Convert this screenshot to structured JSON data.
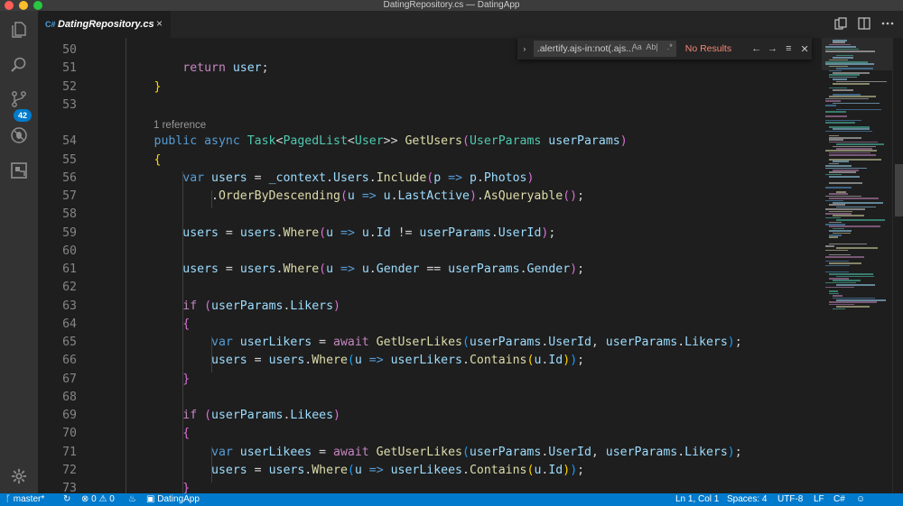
{
  "window": {
    "title": "DatingRepository.cs — DatingApp"
  },
  "activity_bar": {
    "scm_badge": "42"
  },
  "tab": {
    "icon_label": "C#",
    "name": "DatingRepository.cs",
    "close": "×"
  },
  "find_widget": {
    "toggle": "›",
    "query": ".alertify.ajs-in:not(.ajs...",
    "opt_case": "Aa",
    "opt_word": "Ab|",
    "opt_regex": ".*",
    "result": "No Results",
    "prev": "←",
    "next": "→",
    "selection": "≡",
    "close": "✕"
  },
  "editor": {
    "codelens": "1 reference",
    "lines": [
      {
        "n": "50",
        "tokens": []
      },
      {
        "n": "51",
        "tokens": [
          [
            "ctl",
            "            return"
          ],
          [
            "var",
            " user"
          ],
          [
            "pn",
            ";"
          ]
        ]
      },
      {
        "n": "52",
        "tokens": [
          [
            "br",
            "        }"
          ]
        ]
      },
      {
        "n": "53",
        "tokens": []
      },
      {
        "n": "54",
        "tokens": [
          [
            "kw",
            "        public async "
          ],
          [
            "ty",
            "Task"
          ],
          [
            "pn",
            "<"
          ],
          [
            "ty",
            "PagedList"
          ],
          [
            "pn",
            "<"
          ],
          [
            "ty",
            "User"
          ],
          [
            "pn",
            ">> "
          ],
          [
            "fn",
            "GetUsers"
          ],
          [
            "br2",
            "("
          ],
          [
            "ty",
            "UserParams"
          ],
          [
            "var",
            " userParams"
          ],
          [
            "br2",
            ")"
          ]
        ]
      },
      {
        "n": "55",
        "tokens": [
          [
            "br",
            "        {"
          ]
        ]
      },
      {
        "n": "56",
        "tokens": [
          [
            "kw",
            "            var"
          ],
          [
            "var",
            " users"
          ],
          [
            "pn",
            " = "
          ],
          [
            "var",
            "_context"
          ],
          [
            "pn",
            "."
          ],
          [
            "var",
            "Users"
          ],
          [
            "pn",
            "."
          ],
          [
            "fn",
            "Include"
          ],
          [
            "br2",
            "("
          ],
          [
            "var",
            "p"
          ],
          [
            "kw",
            " =>"
          ],
          [
            "var",
            " p"
          ],
          [
            "pn",
            "."
          ],
          [
            "var",
            "Photos"
          ],
          [
            "br2",
            ")"
          ]
        ]
      },
      {
        "n": "57",
        "tokens": [
          [
            "pn",
            "                ."
          ],
          [
            "fn",
            "OrderByDescending"
          ],
          [
            "br2",
            "("
          ],
          [
            "var",
            "u"
          ],
          [
            "kw",
            " =>"
          ],
          [
            "var",
            " u"
          ],
          [
            "pn",
            "."
          ],
          [
            "var",
            "LastActive"
          ],
          [
            "br2",
            ")"
          ],
          [
            "pn",
            "."
          ],
          [
            "fn",
            "AsQueryable"
          ],
          [
            "br2",
            "()"
          ],
          [
            "pn",
            ";"
          ]
        ]
      },
      {
        "n": "58",
        "tokens": []
      },
      {
        "n": "59",
        "tokens": [
          [
            "var",
            "            users"
          ],
          [
            "pn",
            " = "
          ],
          [
            "var",
            "users"
          ],
          [
            "pn",
            "."
          ],
          [
            "fn",
            "Where"
          ],
          [
            "br2",
            "("
          ],
          [
            "var",
            "u"
          ],
          [
            "kw",
            " =>"
          ],
          [
            "var",
            " u"
          ],
          [
            "pn",
            "."
          ],
          [
            "var",
            "Id"
          ],
          [
            "pn",
            " != "
          ],
          [
            "var",
            "userParams"
          ],
          [
            "pn",
            "."
          ],
          [
            "var",
            "UserId"
          ],
          [
            "br2",
            ")"
          ],
          [
            "pn",
            ";"
          ]
        ]
      },
      {
        "n": "60",
        "tokens": []
      },
      {
        "n": "61",
        "tokens": [
          [
            "var",
            "            users"
          ],
          [
            "pn",
            " = "
          ],
          [
            "var",
            "users"
          ],
          [
            "pn",
            "."
          ],
          [
            "fn",
            "Where"
          ],
          [
            "br2",
            "("
          ],
          [
            "var",
            "u"
          ],
          [
            "kw",
            " =>"
          ],
          [
            "var",
            " u"
          ],
          [
            "pn",
            "."
          ],
          [
            "var",
            "Gender"
          ],
          [
            "pn",
            " == "
          ],
          [
            "var",
            "userParams"
          ],
          [
            "pn",
            "."
          ],
          [
            "var",
            "Gender"
          ],
          [
            "br2",
            ")"
          ],
          [
            "pn",
            ";"
          ]
        ]
      },
      {
        "n": "62",
        "tokens": []
      },
      {
        "n": "63",
        "tokens": [
          [
            "ctl",
            "            if"
          ],
          [
            "br2",
            " ("
          ],
          [
            "var",
            "userParams"
          ],
          [
            "pn",
            "."
          ],
          [
            "var",
            "Likers"
          ],
          [
            "br2",
            ")"
          ]
        ]
      },
      {
        "n": "64",
        "tokens": [
          [
            "br2",
            "            {"
          ]
        ]
      },
      {
        "n": "65",
        "tokens": [
          [
            "kw",
            "                var"
          ],
          [
            "var",
            " userLikers"
          ],
          [
            "pn",
            " = "
          ],
          [
            "ctl",
            "await "
          ],
          [
            "fn",
            "GetUserLikes"
          ],
          [
            "br3",
            "("
          ],
          [
            "var",
            "userParams"
          ],
          [
            "pn",
            "."
          ],
          [
            "var",
            "UserId"
          ],
          [
            "pn",
            ", "
          ],
          [
            "var",
            "userParams"
          ],
          [
            "pn",
            "."
          ],
          [
            "var",
            "Likers"
          ],
          [
            "br3",
            ")"
          ],
          [
            "pn",
            ";"
          ]
        ]
      },
      {
        "n": "66",
        "tokens": [
          [
            "var",
            "                users"
          ],
          [
            "pn",
            " = "
          ],
          [
            "var",
            "users"
          ],
          [
            "pn",
            "."
          ],
          [
            "fn",
            "Where"
          ],
          [
            "br3",
            "("
          ],
          [
            "var",
            "u"
          ],
          [
            "kw",
            " =>"
          ],
          [
            "var",
            " userLikers"
          ],
          [
            "pn",
            "."
          ],
          [
            "fn",
            "Contains"
          ],
          [
            "br",
            "("
          ],
          [
            "var",
            "u"
          ],
          [
            "pn",
            "."
          ],
          [
            "var",
            "Id"
          ],
          [
            "br",
            ")"
          ],
          [
            "br3",
            ")"
          ],
          [
            "pn",
            ";"
          ]
        ]
      },
      {
        "n": "67",
        "tokens": [
          [
            "br2",
            "            }"
          ]
        ]
      },
      {
        "n": "68",
        "tokens": []
      },
      {
        "n": "69",
        "tokens": [
          [
            "ctl",
            "            if"
          ],
          [
            "br2",
            " ("
          ],
          [
            "var",
            "userParams"
          ],
          [
            "pn",
            "."
          ],
          [
            "var",
            "Likees"
          ],
          [
            "br2",
            ")"
          ]
        ]
      },
      {
        "n": "70",
        "tokens": [
          [
            "br2",
            "            {"
          ]
        ]
      },
      {
        "n": "71",
        "tokens": [
          [
            "kw",
            "                var"
          ],
          [
            "var",
            " userLikees"
          ],
          [
            "pn",
            " = "
          ],
          [
            "ctl",
            "await "
          ],
          [
            "fn",
            "GetUserLikes"
          ],
          [
            "br3",
            "("
          ],
          [
            "var",
            "userParams"
          ],
          [
            "pn",
            "."
          ],
          [
            "var",
            "UserId"
          ],
          [
            "pn",
            ", "
          ],
          [
            "var",
            "userParams"
          ],
          [
            "pn",
            "."
          ],
          [
            "var",
            "Likers"
          ],
          [
            "br3",
            ")"
          ],
          [
            "pn",
            ";"
          ]
        ]
      },
      {
        "n": "72",
        "tokens": [
          [
            "var",
            "                users"
          ],
          [
            "pn",
            " = "
          ],
          [
            "var",
            "users"
          ],
          [
            "pn",
            "."
          ],
          [
            "fn",
            "Where"
          ],
          [
            "br3",
            "("
          ],
          [
            "var",
            "u"
          ],
          [
            "kw",
            " =>"
          ],
          [
            "var",
            " userLikees"
          ],
          [
            "pn",
            "."
          ],
          [
            "fn",
            "Contains"
          ],
          [
            "br",
            "("
          ],
          [
            "var",
            "u"
          ],
          [
            "pn",
            "."
          ],
          [
            "var",
            "Id"
          ],
          [
            "br",
            ")"
          ],
          [
            "br3",
            ")"
          ],
          [
            "pn",
            ";"
          ]
        ]
      },
      {
        "n": "73",
        "tokens": [
          [
            "br2",
            "            }"
          ]
        ]
      }
    ]
  },
  "status_bar": {
    "branch": "master*",
    "errors": "0",
    "warnings": "0",
    "project": "DatingApp",
    "position": "Ln 1, Col 1",
    "spaces": "Spaces: 4",
    "encoding": "UTF-8",
    "eol": "LF",
    "language": "C#"
  },
  "colors": {
    "accent": "#007acc",
    "keyword": "#569cd6",
    "control": "#c586c0",
    "type": "#4ec9b0",
    "function": "#dcdcaa",
    "variable": "#9cdcfe",
    "no_results": "#f48771"
  }
}
